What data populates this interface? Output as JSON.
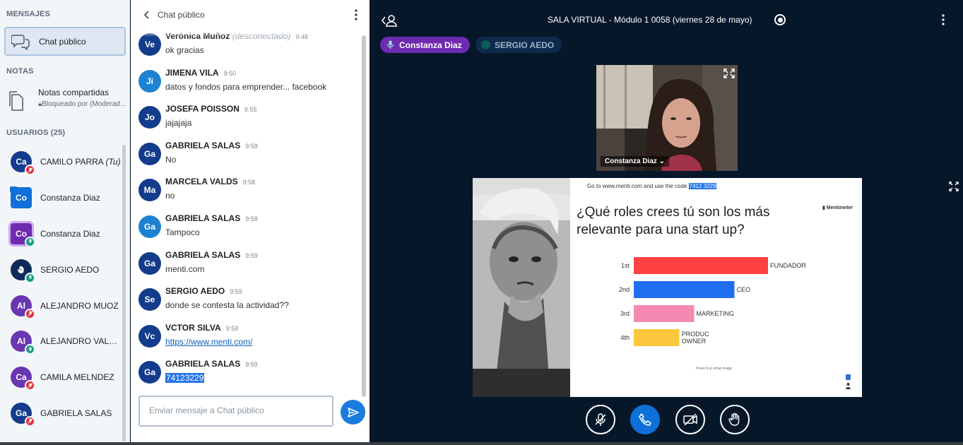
{
  "sidebar": {
    "messages_title": "MENSAJES",
    "chat_item": "Chat público",
    "notes_title": "NOTAS",
    "notes_item": "Notas compartidas",
    "notes_sub": "Bloqueado por (Moderad...",
    "users_title": "USUARIOS (25)",
    "users": [
      {
        "initials": "Ca",
        "name": "CAMILO PARRA",
        "suffix": "(Tu)",
        "color": "#143c8c",
        "status": "muted"
      },
      {
        "initials": "Co",
        "name": "Constanza Diaz",
        "color": "#0f70d7",
        "status": "presenter"
      },
      {
        "initials": "Co",
        "name": "Constanza Diaz",
        "color": "#6e2bb0",
        "status": "talking"
      },
      {
        "initials": "",
        "name": "SERGIO AEDO",
        "color": "#0f2a5a",
        "status": "talking"
      },
      {
        "initials": "Al",
        "name": "ALEJANDRO MUOZ",
        "color": "#6a36b1",
        "status": "muted"
      },
      {
        "initials": "Al",
        "name": "ALEJANDRO VALEN...",
        "color": "#6a36b1",
        "status": "listen"
      },
      {
        "initials": "Ca",
        "name": "CAMILA MELNDEZ",
        "color": "#6a36b1",
        "status": "muted"
      },
      {
        "initials": "Ga",
        "name": "GABRIELA SALAS",
        "color": "#143c8c",
        "status": "muted"
      }
    ]
  },
  "chat": {
    "title": "Chat público",
    "input_placeholder": "Enviar mensaje a Chat público",
    "messages": [
      {
        "initials": "Ve",
        "name": "Verónica Muñoz",
        "disc": "(desconectado)",
        "time": "9:48",
        "text": "ok gracias",
        "color": "#143c8c"
      },
      {
        "initials": "Ji",
        "name": "JIMENA VILA",
        "time": "9:50",
        "text": "datos y fondos para emprender... facebook",
        "color": "#1e82d2"
      },
      {
        "initials": "Jo",
        "name": "JOSEFA POISSON",
        "time": "9:55",
        "text": "jajajaja",
        "color": "#143c8c"
      },
      {
        "initials": "Ga",
        "name": "GABRIELA SALAS",
        "time": "9:58",
        "text": "No",
        "color": "#143c8c"
      },
      {
        "initials": "Ma",
        "name": "MARCELA VALDS",
        "time": "9:58",
        "text": "no",
        "color": "#143c8c"
      },
      {
        "initials": "Ga",
        "name": "GABRIELA SALAS",
        "time": "9:58",
        "text": "Tampoco",
        "color": "#1e82d2"
      },
      {
        "initials": "Ga",
        "name": "GABRIELA SALAS",
        "time": "9:59",
        "text": "menti.com",
        "color": "#143c8c"
      },
      {
        "initials": "Se",
        "name": "SERGIO AEDO",
        "time": "9:59",
        "text": "donde se contesta la actividad??",
        "color": "#143c8c"
      },
      {
        "initials": "Vc",
        "name": "VCTOR SILVA",
        "time": "9:59",
        "text": "https://www.menti.com/",
        "color": "#143c8c",
        "kind": "link"
      },
      {
        "initials": "Ga",
        "name": "GABRIELA SALAS",
        "time": "9:59",
        "text": "74123229",
        "color": "#143c8c",
        "kind": "hl"
      }
    ]
  },
  "main": {
    "room_title": "SALA VIRTUAL - Módulo 1 0058 (viernes 28 de mayo)",
    "talkers": [
      "Constanza Diaz",
      "SERGIO AEDO"
    ],
    "webcam_label": "Constanza Diaz ⌄"
  },
  "slide": {
    "code_prefix": "Go to www.menti.com and use the code",
    "code": "7412 3229",
    "question": "¿Qué roles crees tú son los más relevante para una start up?",
    "brand": "Mentimeter",
    "footer": "Press S to show image"
  },
  "chart_data": {
    "type": "bar",
    "orientation": "horizontal",
    "categories": [
      "1st",
      "2nd",
      "3rd",
      "4th"
    ],
    "labels": [
      "FUNDADOR",
      "CEO",
      "MARKETING",
      "PRODUC\nOWNER"
    ],
    "values": [
      100,
      75,
      45,
      34
    ],
    "colors": [
      "#ff4141",
      "#1f6ef0",
      "#f589b1",
      "#fbc73c"
    ]
  },
  "colors": {
    "accent": "#0f70d7",
    "muted_badge": "#e0323c",
    "talking_badge": "#1a9e86",
    "background": "#06172a"
  }
}
